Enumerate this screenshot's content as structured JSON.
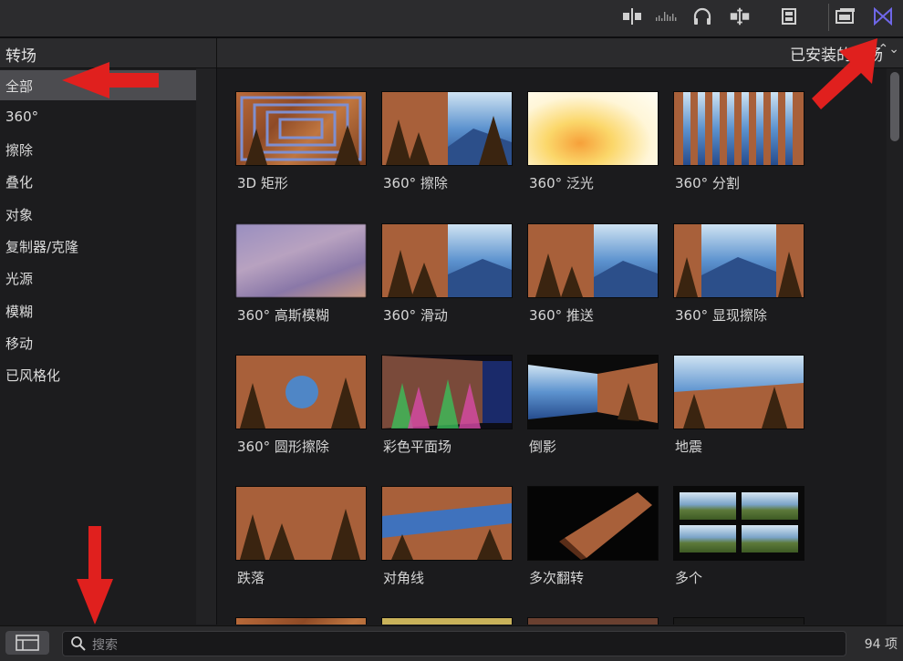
{
  "toolbar": {
    "icons": [
      "split-clip-icon",
      "audio-waveform-icon",
      "headphones-icon",
      "snapping-icon",
      "clip-appearance-icon",
      "window-layout-icon",
      "transitions-icon"
    ],
    "active_color": "#6f67e8"
  },
  "sidebar": {
    "title": "转场",
    "categories": [
      "全部",
      "360°",
      "擦除",
      "叠化",
      "对象",
      "复制器/克隆",
      "光源",
      "模糊",
      "移动",
      "已风格化"
    ],
    "selected_index": 0
  },
  "browser": {
    "filter_label": "已安装的转场",
    "items": [
      {
        "label": "3D 矩形"
      },
      {
        "label": "360° 擦除"
      },
      {
        "label": "360° 泛光"
      },
      {
        "label": "360° 分割"
      },
      {
        "label": "360° 高斯模糊"
      },
      {
        "label": "360° 滑动"
      },
      {
        "label": "360° 推送"
      },
      {
        "label": "360° 显现擦除"
      },
      {
        "label": "360° 圆形擦除"
      },
      {
        "label": "彩色平面场"
      },
      {
        "label": "倒影"
      },
      {
        "label": "地震"
      },
      {
        "label": "跌落"
      },
      {
        "label": "对角线"
      },
      {
        "label": "多次翻转"
      },
      {
        "label": "多个"
      }
    ]
  },
  "footer": {
    "search_placeholder": "搜索",
    "item_count": "94 项"
  },
  "annotations": {
    "arrow_color": "#e0201e"
  }
}
